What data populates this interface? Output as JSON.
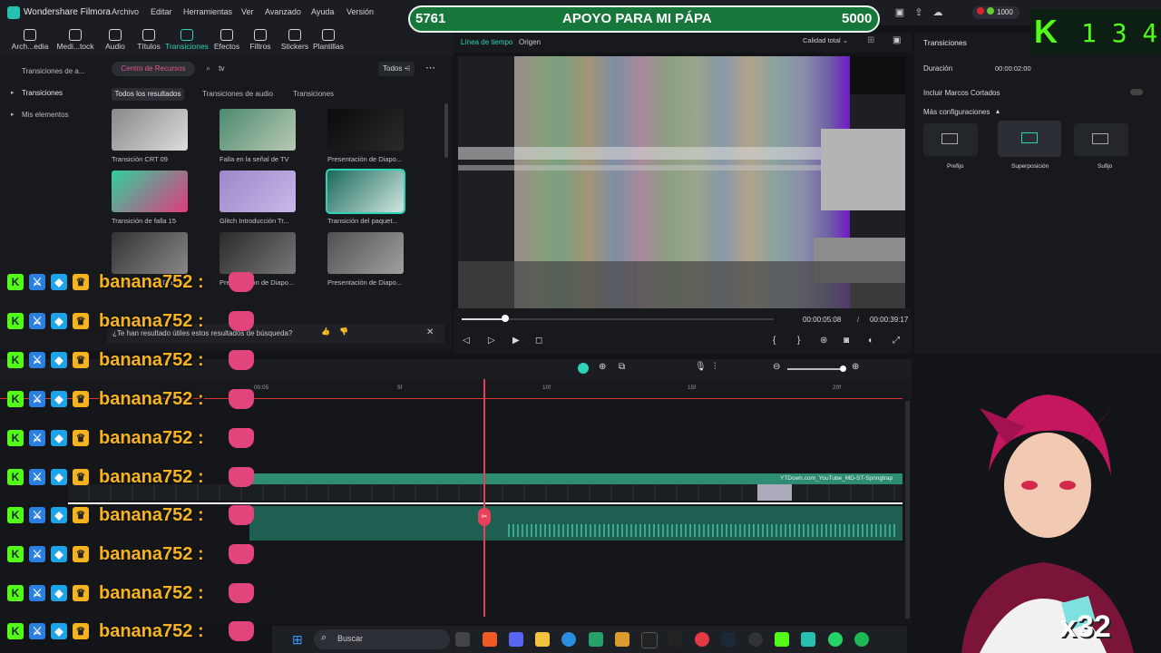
{
  "app": {
    "name": "Wondershare Filmora",
    "menu": [
      "Archivo",
      "Editar",
      "Herramientas",
      "Ver",
      "Avanzado",
      "Ayuda",
      "Versión"
    ],
    "credits": "1000"
  },
  "toolbar": [
    {
      "label": "Arch...edia",
      "icon": "folder-icon"
    },
    {
      "label": "Medi...tock",
      "icon": "stock-icon"
    },
    {
      "label": "Audio",
      "icon": "music-icon"
    },
    {
      "label": "Títulos",
      "icon": "title-icon"
    },
    {
      "label": "Transiciones",
      "icon": "transition-icon",
      "active": true
    },
    {
      "label": "Efectos",
      "icon": "effects-icon"
    },
    {
      "label": "Filtros",
      "icon": "filter-icon"
    },
    {
      "label": "Stickers",
      "icon": "sticker-icon"
    },
    {
      "label": "Plantillas",
      "icon": "template-icon"
    }
  ],
  "sidebar": {
    "items": [
      "Transiciones de a...",
      "Transiciones",
      "Mis elementos"
    ]
  },
  "library": {
    "resource_center": "Centro de Recursos",
    "search_value": "tv",
    "filter": "Todos",
    "tabs": [
      "Todos los resultados",
      "Transiciones de audio",
      "Transiciones"
    ],
    "items": [
      {
        "title": "Transición CRT 09",
        "colors": [
          "#888",
          "#ddd"
        ]
      },
      {
        "title": "Falla en la señal de TV",
        "colors": [
          "#4b8a6e",
          "#b9c9b5"
        ]
      },
      {
        "title": "Presentación de Diapo...",
        "colors": [
          "#0b0b0b",
          "#2a2a2a"
        ]
      },
      {
        "title": "Transición de falla 15",
        "colors": [
          "#2fd0a0",
          "#e03a7a"
        ]
      },
      {
        "title": "Glitch Introducción Tr...",
        "colors": [
          "#9c88c9",
          "#c8b8e8"
        ]
      },
      {
        "title": "Transición del paquet...",
        "colors": [
          "#1a6a5a",
          "#d0e6e0"
        ]
      },
      {
        "title": "Presentación de Diapo...",
        "colors": [
          "#333",
          "#888"
        ]
      },
      {
        "title": "Presentación de Diapo...",
        "colors": [
          "#2b2b2b",
          "#777"
        ]
      },
      {
        "title": "Presentación de Diapo...",
        "colors": [
          "#505050",
          "#a0a0a0"
        ]
      }
    ],
    "feedback": "¿Te han resultado útiles estos resultados de búsqueda?"
  },
  "preview": {
    "tabs": [
      "Línea de tiempo",
      "Origen"
    ],
    "quality": "Calidad total",
    "current_time": "00:00:05:08",
    "total_time": "00:00:39:17",
    "progress": 0.14
  },
  "properties": {
    "title": "Transiciones",
    "duration_label": "Duración",
    "duration_value": "00:00:02:00",
    "include_frames": "Incluir Marcos Cortados",
    "more_settings": "Más configuraciones",
    "modes": [
      "Prefijo",
      "Superposición",
      "Sufijo"
    ]
  },
  "timeline": {
    "ruler": [
      "00:05",
      "5f",
      "10f",
      "15f",
      "20f"
    ],
    "clip_label": "YTDown.com_YouTube_MD-ST-Springtrap"
  },
  "overlays": {
    "donation_left": "5761",
    "donation_title": "APOYO PARA MI PÁPA",
    "donation_right": "5000",
    "kick_counter": "1 3 4",
    "chat_user": "banana752 :",
    "multiplier": "x32"
  },
  "taskbar": {
    "search": "Buscar"
  }
}
